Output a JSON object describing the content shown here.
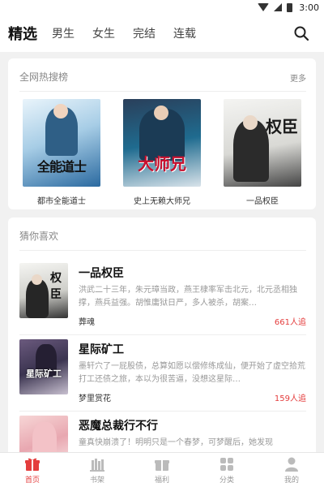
{
  "status_bar": {
    "time": "3:00"
  },
  "top_nav": {
    "tabs": [
      "精选",
      "男生",
      "女生",
      "完结",
      "连载"
    ],
    "active_index": 0
  },
  "hot_search": {
    "title": "全网热搜榜",
    "more": "更多",
    "books": [
      {
        "title": "都市全能道士",
        "cover_text": "全能道士"
      },
      {
        "title": "史上无赖大师兄",
        "cover_text": "大师兄"
      },
      {
        "title": "一品权臣",
        "cover_text": "权臣"
      }
    ]
  },
  "guess": {
    "title": "猜你喜欢",
    "books": [
      {
        "title": "一品权臣",
        "desc": "洪武二十三年，朱元璋当政，燕王棣率军击北元，北元丞相独撑，燕兵益强。胡惟庸狱日严，多人被杀，胡案…",
        "author": "葬魂",
        "count": "661人追",
        "cover_text": "权臣"
      },
      {
        "title": "星际矿工",
        "desc": "墨轩穴了一屁股债，总算如愿以偿修练成仙，便开始了虚空拾荒打工还债之旅，本以为很苦逼，没想这星际…",
        "author": "梦里赏花",
        "count": "159人追",
        "cover_text": "星际矿工"
      },
      {
        "title": "恶魔总裁行不行",
        "desc": "童真快崩溃了！明明只是一个春梦，可梦醒后，她发现",
        "author": "",
        "count": "",
        "cover_text": ""
      }
    ]
  },
  "bottom_nav": {
    "items": [
      "首页",
      "书架",
      "福利",
      "分类",
      "我的"
    ],
    "active_index": 0
  },
  "colors": {
    "accent": "#e43d3d"
  }
}
